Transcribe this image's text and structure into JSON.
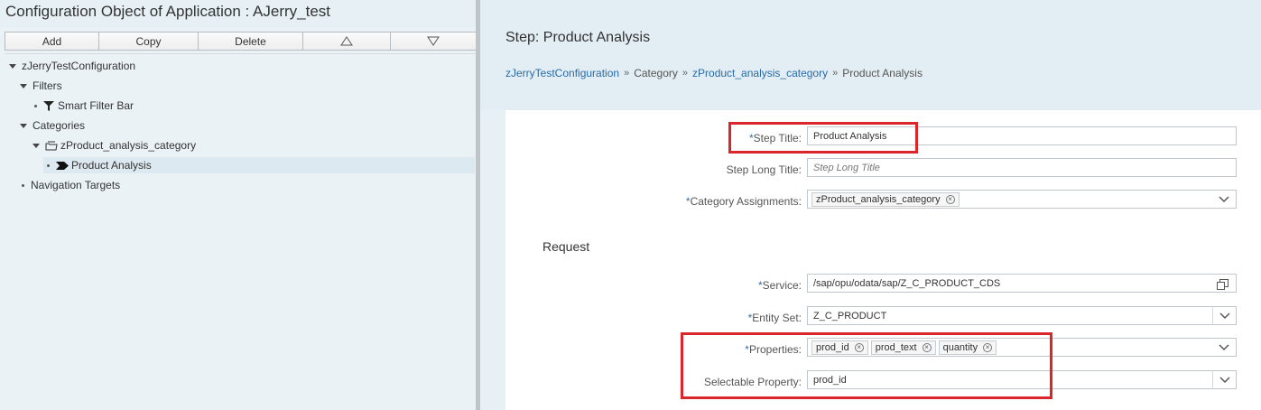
{
  "app": {
    "title": "Configuration Object of Application : AJerry_test"
  },
  "toolbar": {
    "add_label": "Add",
    "copy_label": "Copy",
    "delete_label": "Delete",
    "move_up_icon": "triangle-up-icon",
    "move_down_icon": "triangle-down-icon"
  },
  "tree": {
    "root": "zJerryTestConfiguration",
    "filters": "Filters",
    "smart_filter_bar": "Smart Filter Bar",
    "categories": "Categories",
    "category": "zProduct_analysis_category",
    "step": "Product Analysis",
    "navigation_targets": "Navigation Targets"
  },
  "header": {
    "step_title": "Step: Product Analysis",
    "breadcrumb": [
      "zJerryTestConfiguration",
      "Category",
      "zProduct_analysis_category",
      "Product Analysis"
    ]
  },
  "form": {
    "step_title_label": "Step Title:",
    "step_title_value": "Product Analysis",
    "step_long_title_label": "Step Long Title:",
    "step_long_title_placeholder": "Step Long Title",
    "category_assignments_label": "Category Assignments:",
    "category_assignments_tokens": [
      "zProduct_analysis_category"
    ],
    "request_section": "Request",
    "service_label": "Service:",
    "service_value": "/sap/opu/odata/sap/Z_C_PRODUCT_CDS",
    "entity_set_label": "Entity Set:",
    "entity_set_value": "Z_C_PRODUCT",
    "properties_label": "Properties:",
    "properties_tokens": [
      "prod_id",
      "prod_text",
      "quantity"
    ],
    "selectable_property_label": "Selectable Property:",
    "selectable_property_value": "prod_id",
    "required_marker": "*"
  },
  "colors": {
    "highlight": "#d9262b",
    "link": "#2a6aa6",
    "required": "#3b6ea5"
  }
}
